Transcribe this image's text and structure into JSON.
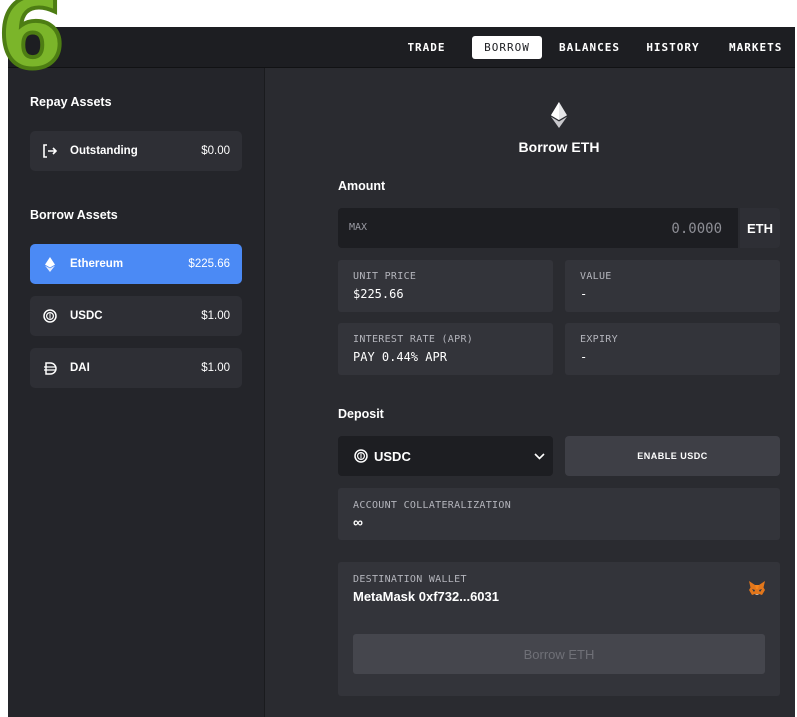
{
  "badge": "6",
  "nav": {
    "items": [
      "TRADE",
      "BORROW",
      "BALANCES",
      "HISTORY",
      "MARKETS"
    ],
    "active": "BORROW"
  },
  "sidebar": {
    "repay_title": "Repay Assets",
    "repay_items": [
      {
        "icon": "outstanding-arrow-icon",
        "label": "Outstanding",
        "value": "$0.00"
      }
    ],
    "borrow_title": "Borrow Assets",
    "borrow_items": [
      {
        "icon": "ethereum-icon",
        "label": "Ethereum",
        "value": "$225.66",
        "active": true
      },
      {
        "icon": "usdc-icon",
        "label": "USDC",
        "value": "$1.00",
        "active": false
      },
      {
        "icon": "dai-icon",
        "label": "DAI",
        "value": "$1.00",
        "active": false
      }
    ]
  },
  "main": {
    "title": "Borrow ETH",
    "amount": {
      "label": "Amount",
      "max_label": "MAX",
      "placeholder": "0.0000",
      "unit": "ETH"
    },
    "unit_price": {
      "label": "UNIT PRICE",
      "value": "$225.66"
    },
    "value": {
      "label": "VALUE",
      "value": "-"
    },
    "interest_rate": {
      "label": "INTEREST RATE (APR)",
      "value": "PAY 0.44% APR"
    },
    "expiry": {
      "label": "EXPIRY",
      "value": "-"
    },
    "deposit": {
      "label": "Deposit",
      "selected": "USDC",
      "enable_button": "ENABLE USDC"
    },
    "collateralization": {
      "label": "ACCOUNT COLLATERALIZATION",
      "value": "∞"
    },
    "wallet": {
      "label": "DESTINATION WALLET",
      "value": "MetaMask 0xf732...6031",
      "icon": "metamask-fox-icon"
    },
    "borrow_button": "Borrow ETH"
  },
  "colors": {
    "app_background": "#2a2b30",
    "sidebar_background": "#24252a",
    "active_accent": "#4b8af5",
    "badge_green": "#7bb52a"
  }
}
